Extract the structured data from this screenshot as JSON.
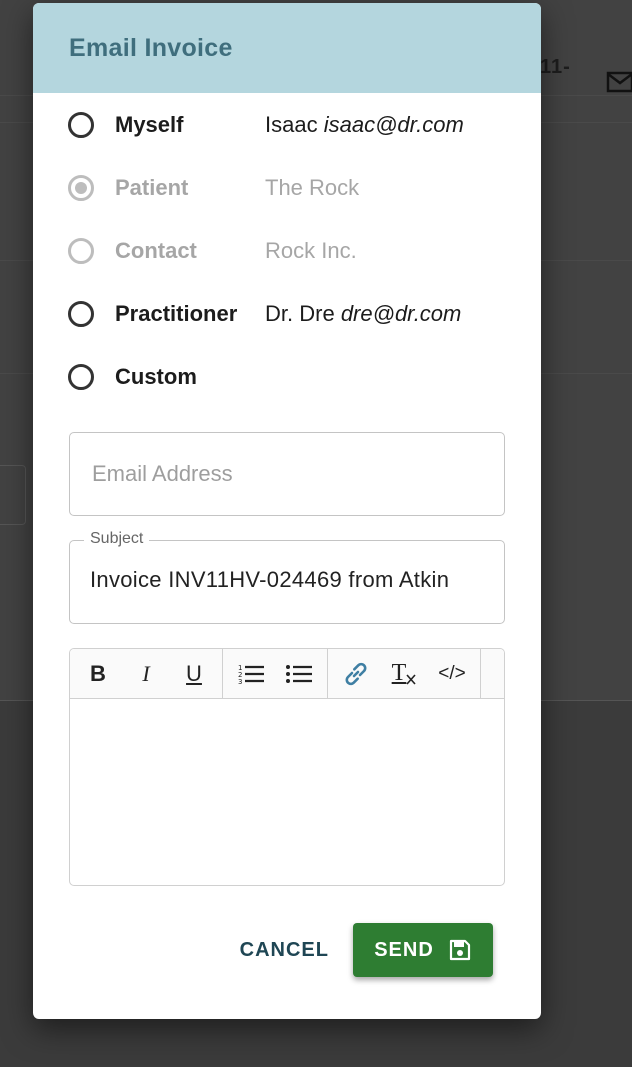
{
  "background": {
    "partial_text": "11-"
  },
  "dialog": {
    "title": "Email Invoice",
    "recipients": [
      {
        "label": "Myself",
        "name": "Isaac",
        "email": "isaac@dr.com",
        "selected": false,
        "disabled": false
      },
      {
        "label": "Patient",
        "name": "The Rock",
        "email": "",
        "selected": true,
        "disabled": true
      },
      {
        "label": "Contact",
        "name": "Rock Inc.",
        "email": "",
        "selected": false,
        "disabled": true
      },
      {
        "label": "Practitioner",
        "name": "Dr. Dre",
        "email": "dre@dr.com",
        "selected": false,
        "disabled": false
      },
      {
        "label": "Custom",
        "name": "",
        "email": "",
        "selected": false,
        "disabled": false
      }
    ],
    "email_field": {
      "placeholder": "Email Address",
      "value": ""
    },
    "subject_field": {
      "label": "Subject",
      "value": "Invoice INV11HV-024469 from Atkin"
    },
    "toolbar": {
      "bold": "B",
      "italic": "I",
      "underline": "U",
      "clear_format": "T",
      "code": "</>"
    },
    "actions": {
      "cancel": "CANCEL",
      "send": "SEND"
    }
  },
  "colors": {
    "header_bg": "#b4d6de",
    "title": "#3f6e7d",
    "send_bg": "#2e7d32",
    "cancel_text": "#1f4654"
  }
}
